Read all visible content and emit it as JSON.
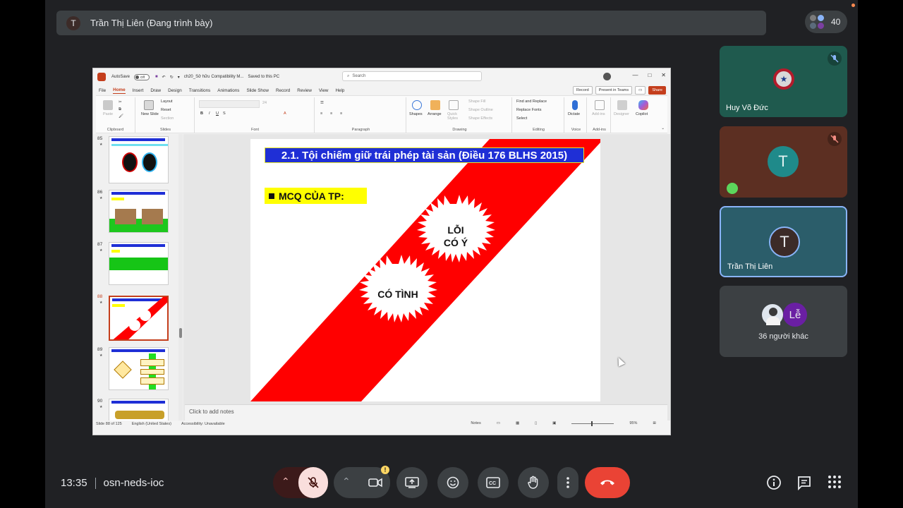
{
  "meet": {
    "presenter": {
      "avatar_letter": "T",
      "label": "Trần Thị Liên (Đang trình bày)"
    },
    "participant_count": "40",
    "tiles": [
      {
        "name": "Huy Võ Đức",
        "muted": true
      },
      {
        "name": "",
        "avatar_letter": "T",
        "muted": true
      },
      {
        "name": "Trần Thị Liên",
        "avatar_letter": "T",
        "active_speaker": true
      },
      {
        "name": "36 người khác",
        "avatar_letter": "Lễ"
      }
    ],
    "time": "13:35",
    "meeting_code": "osn-neds-ioc",
    "colors": {
      "end_call": "#ea4335",
      "mic_off": "#f9dedc",
      "highlight": "#8ab4f8"
    }
  },
  "ppt": {
    "title_bar": {
      "autosave": "AutoSave",
      "autosave_state": "Off",
      "file_name": "ch20_Sở hữu",
      "compat": "Compatibility M...",
      "saved": "Saved to this PC",
      "search_placeholder": "Search"
    },
    "tabs": [
      "File",
      "Home",
      "Insert",
      "Draw",
      "Design",
      "Transitions",
      "Animations",
      "Slide Show",
      "Record",
      "Review",
      "View",
      "Help"
    ],
    "tab_buttons": {
      "record": "Record",
      "present": "Present in Teams",
      "share": "Share"
    },
    "ribbon": {
      "clipboard": {
        "label": "Clipboard",
        "paste": "Paste"
      },
      "slides": {
        "label": "Slides",
        "new_slide": "New Slide",
        "layout": "Layout",
        "reset": "Reset",
        "section": "Section"
      },
      "font": {
        "label": "Font",
        "size": "24"
      },
      "paragraph": {
        "label": "Paragraph"
      },
      "drawing": {
        "label": "Drawing",
        "shapes": "Shapes",
        "arrange": "Arrange",
        "quick_styles": "Quick Styles",
        "shape_fill": "Shape Fill",
        "shape_outline": "Shape Outline",
        "shape_effects": "Shape Effects"
      },
      "editing": {
        "label": "Editing",
        "find": "Find and Replace",
        "replace_fonts": "Replace Fonts",
        "select": "Select"
      },
      "voice": {
        "label": "Voice",
        "dictate": "Dictate"
      },
      "addins": {
        "label": "Add-ins",
        "addins": "Add-ins"
      },
      "designer": "Designer",
      "copilot": "Copilot"
    },
    "thumbnails": [
      {
        "num": "85"
      },
      {
        "num": "86"
      },
      {
        "num": "87"
      },
      {
        "num": "88",
        "selected": true
      },
      {
        "num": "89"
      },
      {
        "num": "90"
      }
    ],
    "slide": {
      "title": "2.1. Tội chiếm giữ trái phép tài sản (Điều 176 BLHS 2015)",
      "mcq": "MCQ CỦA TP:",
      "burst1_line1": "LỖI",
      "burst1_line2": "CÓ Ý",
      "burst2": "CÓ TÌNH",
      "colors": {
        "stripe": "#ff0000",
        "title_bg": "#1f2fd6",
        "mcq_bg": "#ffff00"
      }
    },
    "notes_placeholder": "Click to add notes",
    "status": {
      "slide_info": "Slide 88 of 125",
      "language": "English (United States)",
      "accessibility": "Accessibility: Unavailable",
      "notes": "Notes",
      "zoom": "95%"
    }
  }
}
